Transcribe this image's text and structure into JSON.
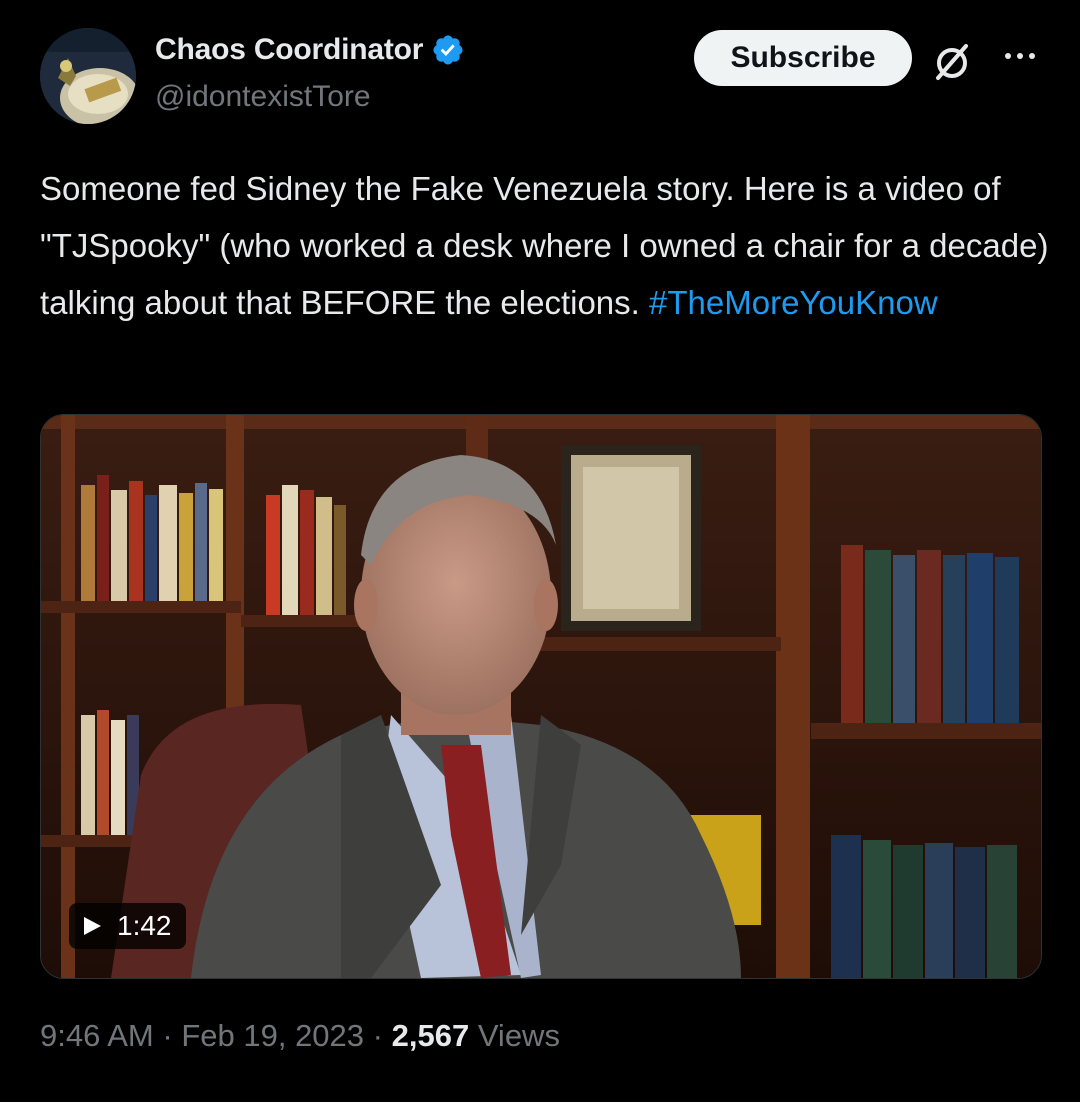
{
  "author": {
    "display_name": "Chaos Coordinator",
    "handle": "@idontexistTore"
  },
  "header": {
    "subscribe_label": "Subscribe",
    "icons": [
      "grok-icon",
      "more-icon",
      "verified-badge-icon"
    ]
  },
  "tweet": {
    "text": "Someone fed Sidney the Fake Venezuela story. Here is a video of \"TJSpooky\" (who worked a desk  where I owned a chair for a decade) talking about that BEFORE the elections. ",
    "hashtag": "#TheMoreYouKnow"
  },
  "video": {
    "duration": "1:42",
    "icon": "play-icon"
  },
  "meta": {
    "time": "9:46 AM",
    "separator": "·",
    "date": "Feb 19, 2023",
    "views_count": "2,567",
    "views_label": "Views"
  },
  "colors": {
    "background": "#000000",
    "text": "#e7e9ea",
    "secondary": "#71767b",
    "link": "#1d9bf0",
    "verified": "#1d9bf0"
  }
}
